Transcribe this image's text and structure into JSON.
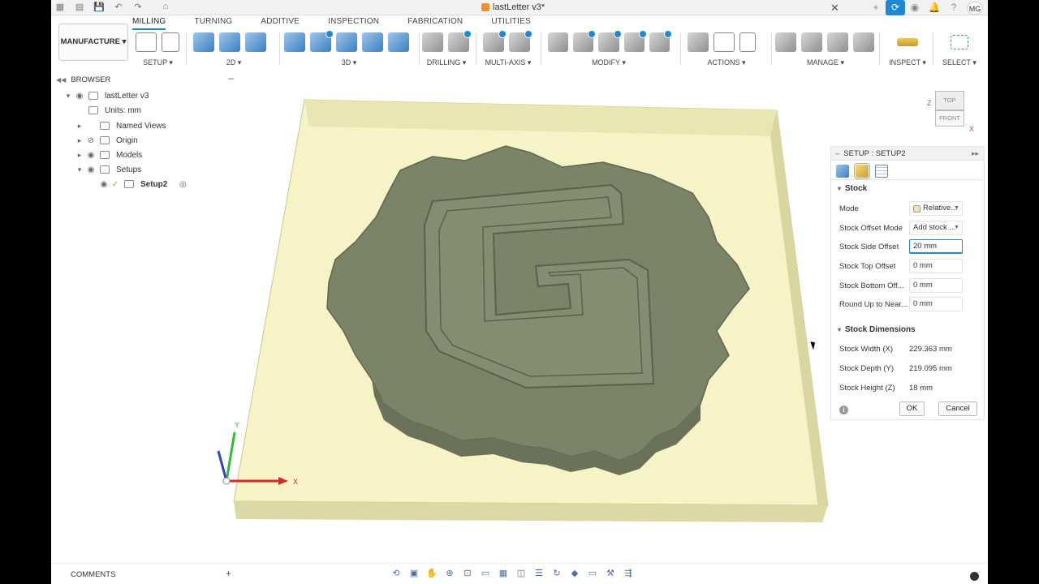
{
  "title_bar": {
    "document_title": "lastLetter v3*",
    "avatar_initials": "MG"
  },
  "ribbon": {
    "tabs": [
      "MILLING",
      "TURNING",
      "ADDITIVE",
      "INSPECTION",
      "FABRICATION",
      "UTILITIES"
    ],
    "selected_tab": "MILLING",
    "workspace": "MANUFACTURE",
    "groups": [
      "SETUP",
      "2D",
      "3D",
      "DRILLING",
      "MULTI-AXIS",
      "MODIFY",
      "ACTIONS",
      "MANAGE",
      "INSPECT",
      "SELECT"
    ]
  },
  "browser": {
    "header": "BROWSER",
    "root": "lastLetter v3",
    "units": "Units: mm",
    "named_views": "Named Views",
    "origin": "Origin",
    "models": "Models",
    "setups": "Setups",
    "setup2": "Setup2"
  },
  "viewcube": {
    "top": "TOP",
    "front": "FRONT",
    "z": "Z",
    "x": "X"
  },
  "axes": {
    "x": "X",
    "y": "Y"
  },
  "setup_panel": {
    "title": "SETUP : SETUP2",
    "stock_section": "Stock",
    "mode_label": "Mode",
    "mode_value": "Relative...",
    "offset_mode_label": "Stock Offset Mode",
    "offset_mode_value": "Add stock ...",
    "side_offset_label": "Stock Side Offset",
    "side_offset_value": "20 mm",
    "top_offset_label": "Stock Top Offset",
    "top_offset_value": "0 mm",
    "bottom_offset_label": "Stock Bottom Off...",
    "bottom_offset_value": "0 mm",
    "round_label": "Round Up to Near...",
    "round_value": "0 mm",
    "dimensions_section": "Stock Dimensions",
    "width_label": "Stock Width (X)",
    "width_value": "229.363 mm",
    "depth_label": "Stock Depth (Y)",
    "depth_value": "219.095 mm",
    "height_label": "Stock Height (Z)",
    "height_value": "18 mm",
    "ok": "OK",
    "cancel": "Cancel"
  },
  "comments": {
    "label": "COMMENTS"
  },
  "colors": {
    "accent": "#1e88d4",
    "stock": "#f6f2c4",
    "part": "#7c8468"
  }
}
